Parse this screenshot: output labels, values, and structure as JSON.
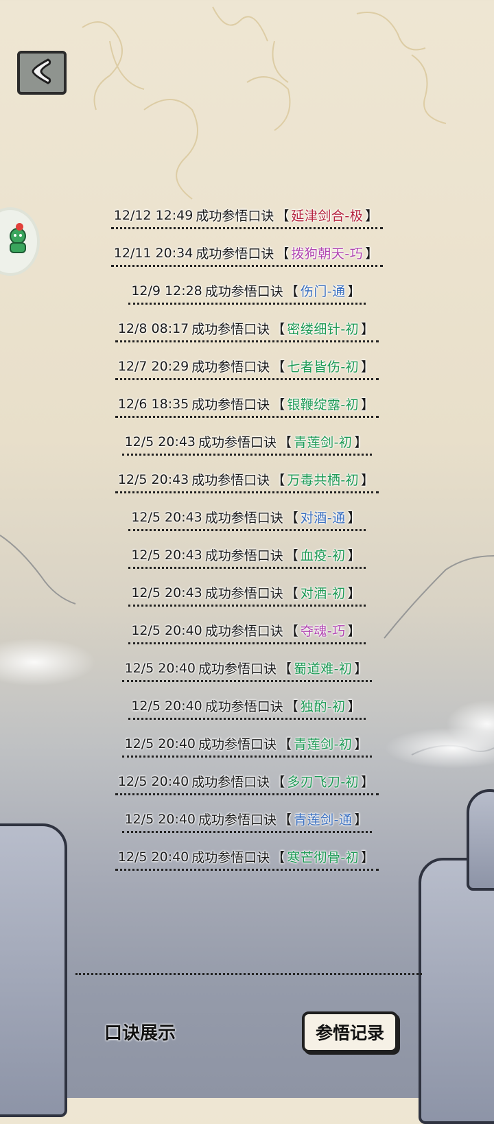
{
  "back_icon": "chevron-left-icon",
  "side_badge_icon": "character-avatar-icon",
  "records": [
    {
      "time": "12/12 12:49",
      "action": "成功参悟口诀",
      "skill": "延津剑合-极",
      "level": "ji"
    },
    {
      "time": "12/11 20:34",
      "action": "成功参悟口诀",
      "skill": "拨狗朝天-巧",
      "level": "qiao"
    },
    {
      "time": "12/9 12:28",
      "action": "成功参悟口诀",
      "skill": "伤门-通",
      "level": "tong"
    },
    {
      "time": "12/8 08:17",
      "action": "成功参悟口诀",
      "skill": "密缕细针-初",
      "level": "chu"
    },
    {
      "time": "12/7 20:29",
      "action": "成功参悟口诀",
      "skill": "七者皆伤-初",
      "level": "chu"
    },
    {
      "time": "12/6 18:35",
      "action": "成功参悟口诀",
      "skill": "银鞭绽露-初",
      "level": "chu"
    },
    {
      "time": "12/5 20:43",
      "action": "成功参悟口诀",
      "skill": "青莲剑-初",
      "level": "chu"
    },
    {
      "time": "12/5 20:43",
      "action": "成功参悟口诀",
      "skill": "万毒共栖-初",
      "level": "chu"
    },
    {
      "time": "12/5 20:43",
      "action": "成功参悟口诀",
      "skill": "对酒-通",
      "level": "tong"
    },
    {
      "time": "12/5 20:43",
      "action": "成功参悟口诀",
      "skill": "血疫-初",
      "level": "chu"
    },
    {
      "time": "12/5 20:43",
      "action": "成功参悟口诀",
      "skill": "对酒-初",
      "level": "chu"
    },
    {
      "time": "12/5 20:40",
      "action": "成功参悟口诀",
      "skill": "夺魂-巧",
      "level": "qiao"
    },
    {
      "time": "12/5 20:40",
      "action": "成功参悟口诀",
      "skill": "蜀道难-初",
      "level": "chu"
    },
    {
      "time": "12/5 20:40",
      "action": "成功参悟口诀",
      "skill": "独酌-初",
      "level": "chu"
    },
    {
      "time": "12/5 20:40",
      "action": "成功参悟口诀",
      "skill": "青莲剑-初",
      "level": "chu"
    },
    {
      "time": "12/5 20:40",
      "action": "成功参悟口诀",
      "skill": "多刃飞刀-初",
      "level": "chu"
    },
    {
      "time": "12/5 20:40",
      "action": "成功参悟口诀",
      "skill": "青莲剑-通",
      "level": "tong"
    },
    {
      "time": "12/5 20:40",
      "action": "成功参悟口诀",
      "skill": "寒芒彻骨-初",
      "level": "chu"
    }
  ],
  "level_colors": {
    "ji": "#b5243f",
    "qiao": "#b043b0",
    "tong": "#3a6fbf",
    "chu": "#1d9a55"
  },
  "brackets": {
    "open": "【",
    "close": "】"
  },
  "tabs": {
    "showcase_label": "口诀展示",
    "records_label": "参悟记录"
  }
}
